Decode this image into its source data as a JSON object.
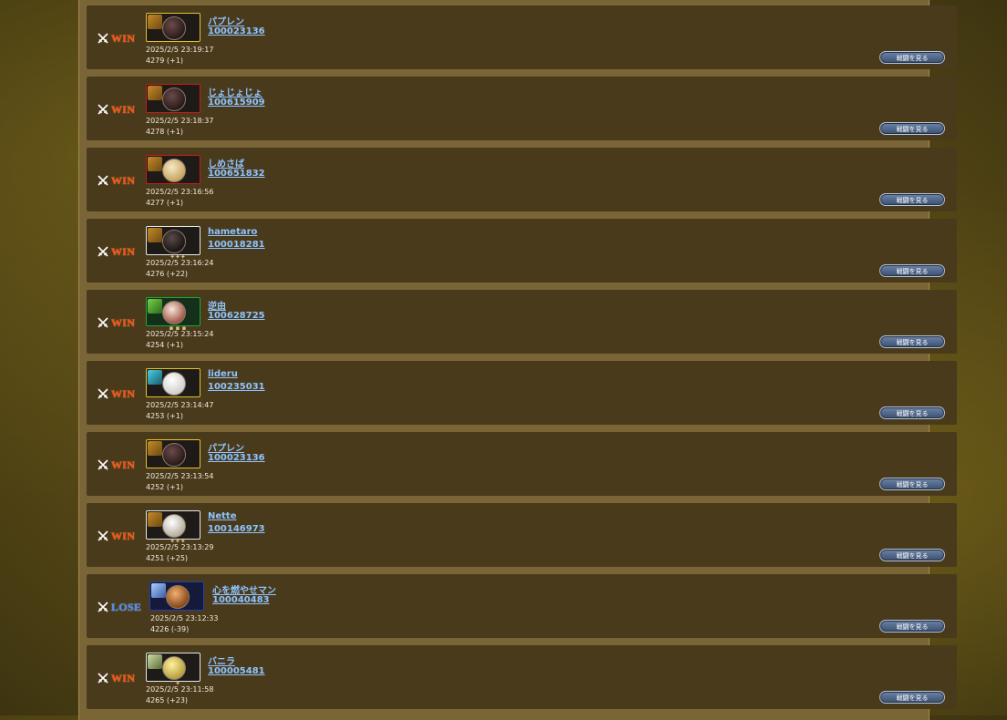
{
  "view_battle_label": "戦闘を見る",
  "records": [
    {
      "result": "WIN",
      "name": "パプレン",
      "id": "100023136",
      "time": "2025/2/5 23:19:17",
      "score": "4279 (+1)",
      "frame": "gold"
    },
    {
      "result": "WIN",
      "name": "じょじょじょ",
      "id": "100615909",
      "time": "2025/2/5 23:18:37",
      "score": "4278 (+1)",
      "frame": "red"
    },
    {
      "result": "WIN",
      "name": "しめさば",
      "id": "100651832",
      "time": "2025/2/5 23:16:56",
      "score": "4277 (+1)",
      "frame": "red"
    },
    {
      "result": "WIN",
      "name": "hametaro",
      "id": "100018281",
      "time": "2025/2/5 23:16:24",
      "score": "4276 (+22)",
      "frame": "white"
    },
    {
      "result": "WIN",
      "name": "逆由",
      "id": "100628725",
      "time": "2025/2/5 23:15:24",
      "score": "4254 (+1)",
      "frame": "green"
    },
    {
      "result": "WIN",
      "name": "lideru",
      "id": "100235031",
      "time": "2025/2/5 23:14:47",
      "score": "4253 (+1)",
      "frame": "gold"
    },
    {
      "result": "WIN",
      "name": "パプレン",
      "id": "100023136",
      "time": "2025/2/5 23:13:54",
      "score": "4252 (+1)",
      "frame": "gold"
    },
    {
      "result": "WIN",
      "name": "Nette",
      "id": "100146973",
      "time": "2025/2/5 23:13:29",
      "score": "4251 (+25)",
      "frame": "white"
    },
    {
      "result": "LOSE",
      "name": "心を燃やせマン",
      "id": "100040483",
      "time": "2025/2/5 23:12:33",
      "score": "4226 (-39)",
      "frame": "blue"
    },
    {
      "result": "WIN",
      "name": "バニラ",
      "id": "100005481",
      "time": "2025/2/5 23:11:58",
      "score": "4265 (+23)",
      "frame": "white"
    }
  ],
  "colors": {
    "win": "#ff4a1a",
    "lose": "#4a8aff",
    "link": "#8ec4ff",
    "row_bg": "#4a3a1c",
    "panel_bg": "#7a6536"
  },
  "icons": {
    "result": "crossed-swords-icon",
    "unit": "unit-icon",
    "avatar": "avatar"
  }
}
